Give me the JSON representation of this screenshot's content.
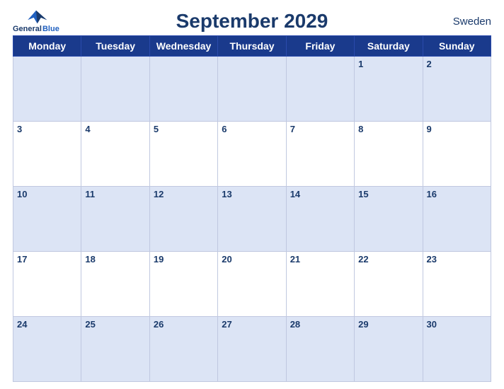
{
  "header": {
    "title": "September 2029",
    "country": "Sweden",
    "logo": {
      "line1": "General",
      "line2": "Blue"
    }
  },
  "weekdays": [
    "Monday",
    "Tuesday",
    "Wednesday",
    "Thursday",
    "Friday",
    "Saturday",
    "Sunday"
  ],
  "weeks": [
    [
      null,
      null,
      null,
      null,
      null,
      1,
      2
    ],
    [
      3,
      4,
      5,
      6,
      7,
      8,
      9
    ],
    [
      10,
      11,
      12,
      13,
      14,
      15,
      16
    ],
    [
      17,
      18,
      19,
      20,
      21,
      22,
      23
    ],
    [
      24,
      25,
      26,
      27,
      28,
      29,
      30
    ]
  ]
}
